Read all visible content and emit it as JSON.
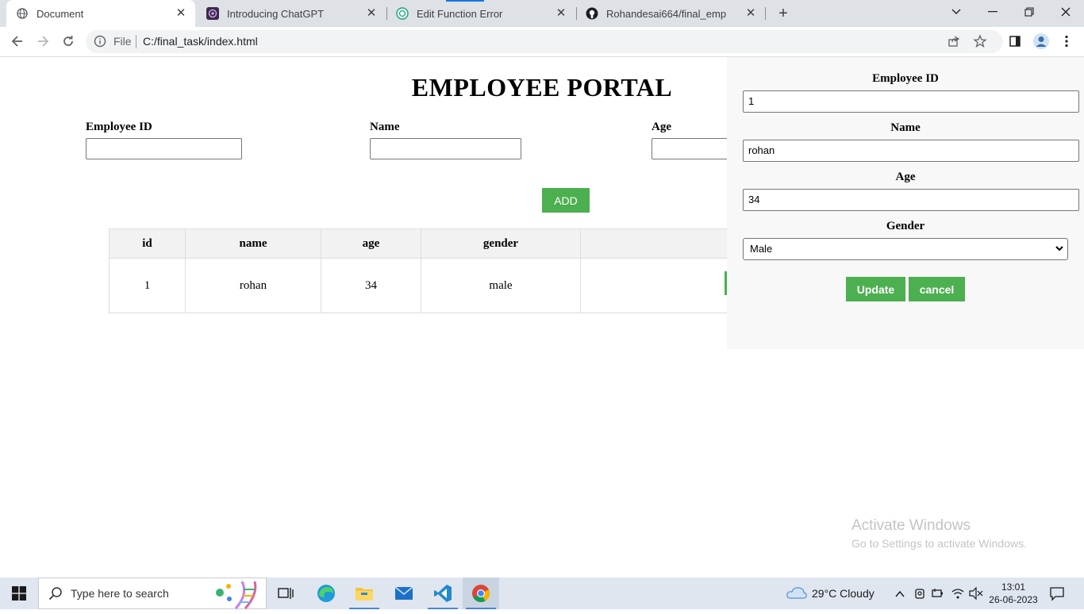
{
  "browser": {
    "tabs": [
      {
        "title": "Document",
        "active": true
      },
      {
        "title": "Introducing ChatGPT",
        "active": false
      },
      {
        "title": "Edit Function Error",
        "active": false
      },
      {
        "title": "Rohandesai664/final_emp",
        "active": false
      }
    ],
    "address": {
      "scheme_label": "File",
      "url": "C:/final_task/index.html"
    }
  },
  "page": {
    "title": "EMPLOYEE PORTAL",
    "form": {
      "id_label": "Employee ID",
      "name_label": "Name",
      "age_label": "Age",
      "add_label": "ADD"
    },
    "table": {
      "headers": [
        "id",
        "name",
        "age",
        "gender",
        ""
      ],
      "rows": [
        {
          "id": "1",
          "name": "rohan",
          "age": "34",
          "gender": "male"
        }
      ]
    }
  },
  "edit_panel": {
    "id_label": "Employee ID",
    "id_value": "1",
    "name_label": "Name",
    "name_value": "rohan",
    "age_label": "Age",
    "age_value": "34",
    "gender_label": "Gender",
    "gender_value": "Male",
    "update_label": "Update",
    "cancel_label": "cancel"
  },
  "watermark": {
    "line1": "Activate Windows",
    "line2": "Go to Settings to activate Windows."
  },
  "taskbar": {
    "search_placeholder": "Type here to search",
    "weather": "29°C  Cloudy",
    "time": "13:01",
    "date": "26-06-2023"
  },
  "colors": {
    "accent_green": "#4caf50",
    "tab_strip": "#dee1e6",
    "taskbar": "#dfe6f0"
  }
}
